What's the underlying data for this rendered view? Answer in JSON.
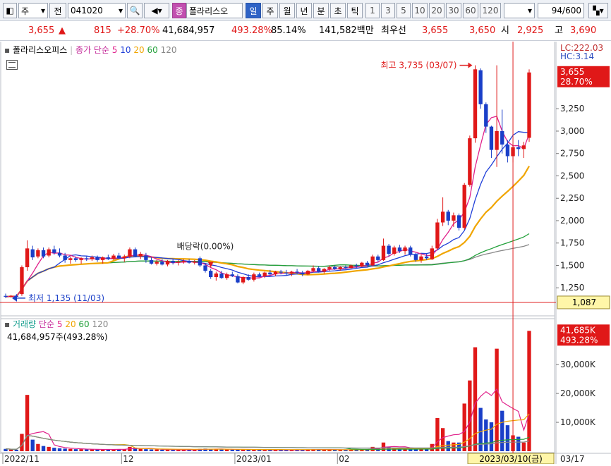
{
  "toolbar": {
    "market": "주",
    "jeon": "전",
    "code": "041020",
    "stock_badge": "종",
    "stock_name": "폴라리스오",
    "periods": [
      "일",
      "주",
      "월",
      "년",
      "분",
      "초",
      "틱"
    ],
    "active_period": "일",
    "intervals": [
      "1",
      "3",
      "5",
      "10",
      "20",
      "30",
      "60",
      "120"
    ],
    "count": "94",
    "count_total": "/600"
  },
  "quote": {
    "price": "3,655",
    "arrow": "▲",
    "change": "815",
    "change_pct": "+28.70%",
    "volume": "41,684,957",
    "volume_ratio": "493.28%",
    "ratio2": "85.14%",
    "amount": "141,582백만",
    "pref_label": "최우선",
    "ask": "3,655",
    "bid": "3,650",
    "open_label": "시",
    "open": "2,925",
    "high_label": "고",
    "high": "3,690"
  },
  "price_panel": {
    "legend_name": "폴라리스오피스",
    "legend_ma": "종가 단순",
    "ma_periods": [
      "5",
      "10",
      "20",
      "60",
      "120"
    ],
    "ma_colors": [
      "#e0208a",
      "#1f3fd8",
      "#f0a500",
      "#22a03a",
      "#888888"
    ],
    "lc_label": "LC:222.03",
    "hc_label": "HC:3.14",
    "current_price": "3,655",
    "current_pct": "28.70%",
    "hline_value": "1,087",
    "high_annot": "최고 3,735 (03/07)",
    "low_annot": "최저 1,135 (11/03)",
    "dividend_annot": "배당락(0.00%)",
    "y_ticks": [
      "3,250",
      "3,000",
      "2,750",
      "2,500",
      "2,250",
      "2,000",
      "1,750",
      "1,500",
      "1,250"
    ],
    "up_color": "#e01818",
    "down_color": "#1a3fc8"
  },
  "volume_panel": {
    "legend_name": "거래량",
    "legend_ma": "단순",
    "ma_periods": [
      "5",
      "20",
      "60",
      "120"
    ],
    "ma_colors": [
      "#e0208a",
      "#f0a500",
      "#22a03a",
      "#888888"
    ],
    "value_text": "41,684,957주(493.28%)",
    "current_volume": "41,685K",
    "current_pct": "493.28%",
    "y_ticks": [
      "30,000K",
      "20,000K",
      "10,000K"
    ]
  },
  "x_axis": {
    "labels": [
      "2022/11",
      "12",
      "2023/01",
      "02",
      "03/17"
    ],
    "crosshair_date": "2023/03/10(금)"
  },
  "chart_data": {
    "type": "candlestick",
    "ylim": [
      1000,
      3850
    ],
    "vol_ylim": [
      0,
      42000000
    ],
    "candles": [
      {
        "o": 1160,
        "h": 1185,
        "l": 1135,
        "c": 1150,
        "v": 800000
      },
      {
        "o": 1150,
        "h": 1170,
        "l": 1140,
        "c": 1160,
        "v": 600000
      },
      {
        "o": 1160,
        "h": 1180,
        "l": 1145,
        "c": 1150,
        "v": 500000
      },
      {
        "o": 1180,
        "h": 1500,
        "l": 1160,
        "c": 1480,
        "v": 6000000
      },
      {
        "o": 1480,
        "h": 1780,
        "l": 1440,
        "c": 1690,
        "v": 19500000
      },
      {
        "o": 1680,
        "h": 1720,
        "l": 1560,
        "c": 1590,
        "v": 4000000
      },
      {
        "o": 1600,
        "h": 1690,
        "l": 1580,
        "c": 1670,
        "v": 2500000
      },
      {
        "o": 1670,
        "h": 1700,
        "l": 1580,
        "c": 1600,
        "v": 1800000
      },
      {
        "o": 1610,
        "h": 1700,
        "l": 1590,
        "c": 1680,
        "v": 1500000
      },
      {
        "o": 1680,
        "h": 1720,
        "l": 1620,
        "c": 1640,
        "v": 1200000
      },
      {
        "o": 1640,
        "h": 1690,
        "l": 1590,
        "c": 1610,
        "v": 1000000
      },
      {
        "o": 1610,
        "h": 1640,
        "l": 1530,
        "c": 1560,
        "v": 900000
      },
      {
        "o": 1560,
        "h": 1600,
        "l": 1520,
        "c": 1580,
        "v": 800000
      },
      {
        "o": 1580,
        "h": 1600,
        "l": 1540,
        "c": 1560,
        "v": 700000
      },
      {
        "o": 1560,
        "h": 1590,
        "l": 1520,
        "c": 1580,
        "v": 700000
      },
      {
        "o": 1580,
        "h": 1600,
        "l": 1550,
        "c": 1570,
        "v": 600000
      },
      {
        "o": 1570,
        "h": 1610,
        "l": 1550,
        "c": 1590,
        "v": 600000
      },
      {
        "o": 1590,
        "h": 1610,
        "l": 1540,
        "c": 1560,
        "v": 600000
      },
      {
        "o": 1560,
        "h": 1600,
        "l": 1520,
        "c": 1590,
        "v": 600000
      },
      {
        "o": 1590,
        "h": 1620,
        "l": 1560,
        "c": 1570,
        "v": 600000
      },
      {
        "o": 1570,
        "h": 1630,
        "l": 1560,
        "c": 1610,
        "v": 700000
      },
      {
        "o": 1610,
        "h": 1640,
        "l": 1570,
        "c": 1580,
        "v": 700000
      },
      {
        "o": 1580,
        "h": 1620,
        "l": 1540,
        "c": 1600,
        "v": 700000
      },
      {
        "o": 1600,
        "h": 1700,
        "l": 1580,
        "c": 1680,
        "v": 1500000
      },
      {
        "o": 1680,
        "h": 1700,
        "l": 1590,
        "c": 1600,
        "v": 1200000
      },
      {
        "o": 1600,
        "h": 1650,
        "l": 1570,
        "c": 1630,
        "v": 800000
      },
      {
        "o": 1610,
        "h": 1640,
        "l": 1530,
        "c": 1560,
        "v": 700000
      },
      {
        "o": 1560,
        "h": 1590,
        "l": 1510,
        "c": 1520,
        "v": 600000
      },
      {
        "o": 1520,
        "h": 1560,
        "l": 1500,
        "c": 1540,
        "v": 600000
      },
      {
        "o": 1540,
        "h": 1570,
        "l": 1500,
        "c": 1510,
        "v": 500000
      },
      {
        "o": 1510,
        "h": 1560,
        "l": 1490,
        "c": 1550,
        "v": 500000
      },
      {
        "o": 1550,
        "h": 1570,
        "l": 1510,
        "c": 1530,
        "v": 500000
      },
      {
        "o": 1530,
        "h": 1560,
        "l": 1500,
        "c": 1540,
        "v": 500000
      },
      {
        "o": 1540,
        "h": 1570,
        "l": 1520,
        "c": 1550,
        "v": 500000
      },
      {
        "o": 1550,
        "h": 1570,
        "l": 1520,
        "c": 1530,
        "v": 500000
      },
      {
        "o": 1530,
        "h": 1560,
        "l": 1510,
        "c": 1540,
        "v": 500000
      },
      {
        "o": 1580,
        "h": 1600,
        "l": 1480,
        "c": 1500,
        "v": 800000
      },
      {
        "o": 1500,
        "h": 1520,
        "l": 1420,
        "c": 1440,
        "v": 900000
      },
      {
        "o": 1440,
        "h": 1460,
        "l": 1350,
        "c": 1370,
        "v": 800000
      },
      {
        "o": 1370,
        "h": 1430,
        "l": 1330,
        "c": 1410,
        "v": 700000
      },
      {
        "o": 1410,
        "h": 1440,
        "l": 1350,
        "c": 1360,
        "v": 600000
      },
      {
        "o": 1360,
        "h": 1420,
        "l": 1340,
        "c": 1400,
        "v": 600000
      },
      {
        "o": 1400,
        "h": 1430,
        "l": 1370,
        "c": 1380,
        "v": 500000
      },
      {
        "o": 1380,
        "h": 1400,
        "l": 1300,
        "c": 1310,
        "v": 700000
      },
      {
        "o": 1310,
        "h": 1380,
        "l": 1290,
        "c": 1370,
        "v": 700000
      },
      {
        "o": 1370,
        "h": 1400,
        "l": 1330,
        "c": 1340,
        "v": 500000
      },
      {
        "o": 1340,
        "h": 1420,
        "l": 1320,
        "c": 1400,
        "v": 500000
      },
      {
        "o": 1400,
        "h": 1420,
        "l": 1370,
        "c": 1380,
        "v": 400000
      },
      {
        "o": 1380,
        "h": 1430,
        "l": 1360,
        "c": 1420,
        "v": 500000
      },
      {
        "o": 1420,
        "h": 1450,
        "l": 1390,
        "c": 1400,
        "v": 500000
      },
      {
        "o": 1400,
        "h": 1440,
        "l": 1380,
        "c": 1430,
        "v": 400000
      },
      {
        "o": 1430,
        "h": 1450,
        "l": 1400,
        "c": 1420,
        "v": 400000
      },
      {
        "o": 1420,
        "h": 1450,
        "l": 1390,
        "c": 1410,
        "v": 400000
      },
      {
        "o": 1410,
        "h": 1440,
        "l": 1380,
        "c": 1430,
        "v": 400000
      },
      {
        "o": 1430,
        "h": 1460,
        "l": 1400,
        "c": 1420,
        "v": 500000
      },
      {
        "o": 1420,
        "h": 1440,
        "l": 1380,
        "c": 1400,
        "v": 500000
      },
      {
        "o": 1400,
        "h": 1450,
        "l": 1390,
        "c": 1440,
        "v": 600000
      },
      {
        "o": 1440,
        "h": 1500,
        "l": 1420,
        "c": 1470,
        "v": 700000
      },
      {
        "o": 1470,
        "h": 1490,
        "l": 1420,
        "c": 1430,
        "v": 600000
      },
      {
        "o": 1430,
        "h": 1470,
        "l": 1410,
        "c": 1460,
        "v": 500000
      },
      {
        "o": 1460,
        "h": 1500,
        "l": 1440,
        "c": 1480,
        "v": 500000
      },
      {
        "o": 1480,
        "h": 1500,
        "l": 1450,
        "c": 1460,
        "v": 500000
      },
      {
        "o": 1460,
        "h": 1490,
        "l": 1440,
        "c": 1480,
        "v": 500000
      },
      {
        "o": 1480,
        "h": 1500,
        "l": 1460,
        "c": 1470,
        "v": 500000
      },
      {
        "o": 1470,
        "h": 1510,
        "l": 1460,
        "c": 1500,
        "v": 600000
      },
      {
        "o": 1500,
        "h": 1520,
        "l": 1470,
        "c": 1490,
        "v": 500000
      },
      {
        "o": 1490,
        "h": 1540,
        "l": 1480,
        "c": 1530,
        "v": 700000
      },
      {
        "o": 1530,
        "h": 1550,
        "l": 1490,
        "c": 1500,
        "v": 600000
      },
      {
        "o": 1500,
        "h": 1620,
        "l": 1490,
        "c": 1600,
        "v": 1500000
      },
      {
        "o": 1600,
        "h": 1620,
        "l": 1540,
        "c": 1560,
        "v": 1000000
      },
      {
        "o": 1560,
        "h": 1800,
        "l": 1550,
        "c": 1720,
        "v": 3000000
      },
      {
        "o": 1720,
        "h": 1740,
        "l": 1600,
        "c": 1630,
        "v": 1400000
      },
      {
        "o": 1630,
        "h": 1720,
        "l": 1610,
        "c": 1700,
        "v": 1200000
      },
      {
        "o": 1700,
        "h": 1730,
        "l": 1640,
        "c": 1660,
        "v": 1000000
      },
      {
        "o": 1660,
        "h": 1720,
        "l": 1620,
        "c": 1700,
        "v": 1100000
      },
      {
        "o": 1700,
        "h": 1720,
        "l": 1600,
        "c": 1620,
        "v": 1100000
      },
      {
        "o": 1620,
        "h": 1640,
        "l": 1540,
        "c": 1560,
        "v": 900000
      },
      {
        "o": 1560,
        "h": 1620,
        "l": 1530,
        "c": 1600,
        "v": 800000
      },
      {
        "o": 1600,
        "h": 1630,
        "l": 1560,
        "c": 1580,
        "v": 700000
      },
      {
        "o": 1570,
        "h": 1720,
        "l": 1560,
        "c": 1690,
        "v": 2500000
      },
      {
        "o": 1690,
        "h": 2020,
        "l": 1680,
        "c": 1980,
        "v": 11500000
      },
      {
        "o": 1980,
        "h": 2260,
        "l": 1940,
        "c": 2100,
        "v": 8000000
      },
      {
        "o": 2100,
        "h": 2120,
        "l": 1950,
        "c": 2000,
        "v": 3500000
      },
      {
        "o": 2000,
        "h": 2090,
        "l": 1930,
        "c": 2060,
        "v": 3000000
      },
      {
        "o": 2060,
        "h": 2080,
        "l": 1890,
        "c": 1920,
        "v": 3000000
      },
      {
        "o": 1920,
        "h": 2420,
        "l": 1900,
        "c": 2400,
        "v": 16500000
      },
      {
        "o": 2400,
        "h": 2950,
        "l": 2380,
        "c": 2920,
        "v": 24500000
      },
      {
        "o": 2920,
        "h": 3735,
        "l": 2870,
        "c": 3690,
        "v": 36000000
      },
      {
        "o": 3680,
        "h": 3700,
        "l": 3250,
        "c": 3300,
        "v": 15000000
      },
      {
        "o": 3300,
        "h": 3320,
        "l": 2980,
        "c": 3050,
        "v": 11000000
      },
      {
        "o": 3050,
        "h": 3060,
        "l": 2700,
        "c": 2790,
        "v": 10000000
      },
      {
        "o": 2790,
        "h": 3735,
        "l": 2600,
        "c": 3000,
        "v": 35500000
      },
      {
        "o": 3000,
        "h": 3240,
        "l": 2750,
        "c": 2850,
        "v": 14000000
      },
      {
        "o": 2850,
        "h": 2900,
        "l": 2650,
        "c": 2720,
        "v": 9000000
      },
      {
        "o": 2720,
        "h": 2850,
        "l": 2650,
        "c": 2820,
        "v": 5500000
      },
      {
        "o": 2820,
        "h": 2900,
        "l": 2720,
        "c": 2800,
        "v": 5000000
      },
      {
        "o": 2800,
        "h": 2880,
        "l": 2700,
        "c": 2840,
        "v": 3000000
      },
      {
        "o": 2925,
        "h": 3690,
        "l": 2880,
        "c": 3655,
        "v": 41684957
      }
    ]
  }
}
